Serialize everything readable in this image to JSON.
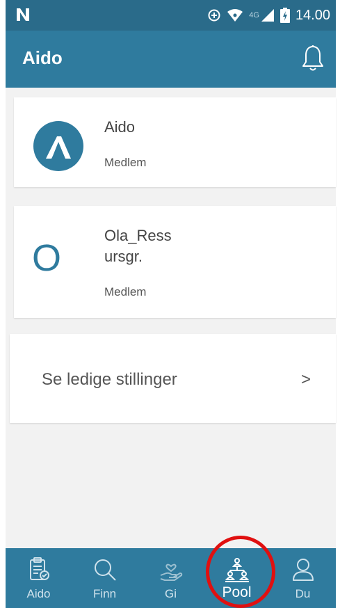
{
  "status_bar": {
    "network": "4G",
    "time": "14.00"
  },
  "app_bar": {
    "title": "Aido"
  },
  "memberships": [
    {
      "name": "Aido",
      "role": "Medlem",
      "avatar": "aido-logo"
    },
    {
      "name": "Ola_Ress ursgr.",
      "role": "Medlem",
      "avatar_letter": "O"
    }
  ],
  "jobs_link": {
    "label": "Se ledige stillinger",
    "chevron": ">"
  },
  "bottom_nav": {
    "items": [
      {
        "label": "Aido",
        "icon": "clipboard-icon"
      },
      {
        "label": "Finn",
        "icon": "search-icon"
      },
      {
        "label": "Gi",
        "icon": "giving-hand-icon"
      },
      {
        "label": "Pool",
        "icon": "pool-network-icon",
        "active": true
      },
      {
        "label": "Du",
        "icon": "profile-icon"
      }
    ]
  },
  "colors": {
    "status_bar": "#2a6b8a",
    "primary": "#2f7b9e",
    "background": "#f2f2f2",
    "highlight": "#e01010"
  }
}
